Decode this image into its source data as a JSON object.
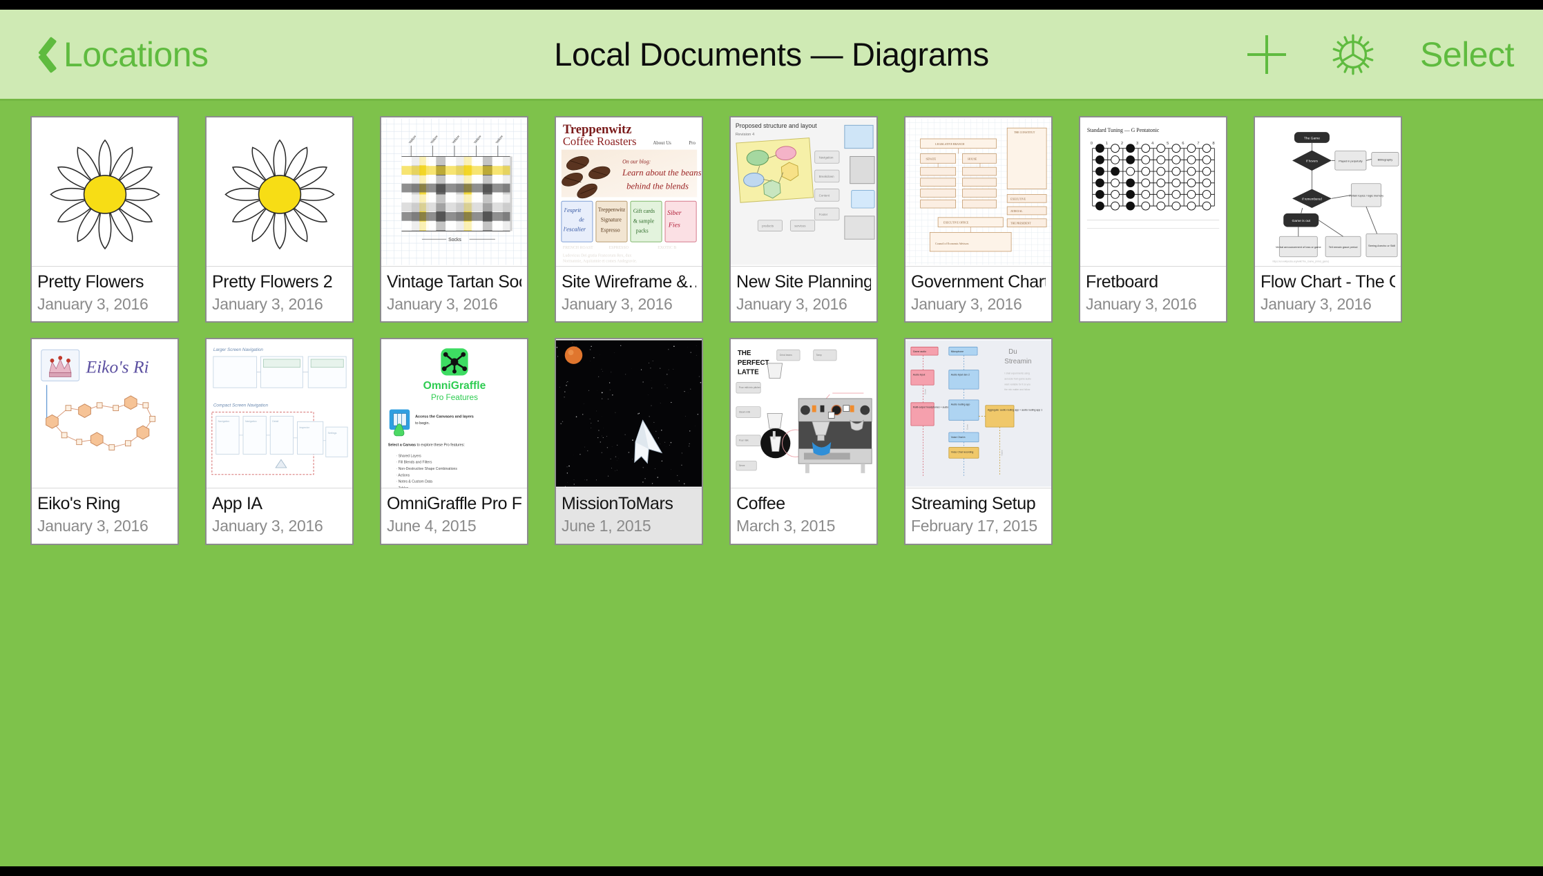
{
  "window": {
    "background_color": "#7ec24b",
    "outer_color": "#000000"
  },
  "navbar": {
    "background_color": "#cfeab4",
    "accent_color": "#5fbb3f",
    "back_label": "Locations",
    "back_icon": "chevron-left-icon",
    "title": "Local Documents — Diagrams",
    "add_icon": "plus-icon",
    "settings_icon": "gear-icon",
    "select_label": "Select"
  },
  "documents": [
    {
      "title": "Pretty Flowers",
      "date": "January 3, 2016",
      "thumb": "daisy",
      "dimmed": false
    },
    {
      "title": "Pretty Flowers 2",
      "date": "January 3, 2016",
      "thumb": "daisy",
      "dimmed": false
    },
    {
      "title": "Vintage Tartan Soc…",
      "date": "January 3, 2016",
      "thumb": "tartan",
      "dimmed": false
    },
    {
      "title": "Site Wireframe &…",
      "date": "January 3, 2016",
      "thumb": "treppenwitz",
      "dimmed": false
    },
    {
      "title": "New Site Planning",
      "date": "January 3, 2016",
      "thumb": "siteplan",
      "dimmed": false
    },
    {
      "title": "Government Chart",
      "date": "January 3, 2016",
      "thumb": "govchart",
      "dimmed": false
    },
    {
      "title": "Fretboard",
      "date": "January 3, 2016",
      "thumb": "fretboard",
      "dimmed": false
    },
    {
      "title": "Flow Chart - The G…",
      "date": "January 3, 2016",
      "thumb": "flowchart",
      "dimmed": false
    },
    {
      "title": "Eiko's Ring",
      "date": "January 3, 2016",
      "thumb": "eikosring",
      "dimmed": false
    },
    {
      "title": "App IA",
      "date": "January 3, 2016",
      "thumb": "appia",
      "dimmed": false
    },
    {
      "title": "OmniGraffle Pro Fe…",
      "date": "June 4, 2015",
      "thumb": "omnigraffle",
      "dimmed": false
    },
    {
      "title": "MissionToMars",
      "date": "June 1, 2015",
      "thumb": "mars",
      "dimmed": true
    },
    {
      "title": "Coffee",
      "date": "March 3, 2015",
      "thumb": "coffee",
      "dimmed": false
    },
    {
      "title": "Streaming Setup",
      "date": "February 17, 2015",
      "thumb": "streaming",
      "dimmed": false
    }
  ],
  "thumbnail_text": {
    "tartan": {
      "label": "Socks"
    },
    "treppenwitz": {
      "brand_line1": "Treppenwitz",
      "brand_line2": "Coffee Roasters",
      "nav1": "About Us",
      "nav2": "Pro",
      "blog_kicker": "On our blog:",
      "blog_line1": "Learn about the beans",
      "blog_line2": "behind the blends",
      "card1": "l'esprit de l'escalier",
      "card2": "Treppenwitz Signature Espresso",
      "card3": "Gift cards & sample packs",
      "card4": "Siber Fies"
    },
    "siteplan": {
      "heading": "Proposed structure and layout",
      "sub": "Revision 4"
    },
    "fretboard": {
      "heading": "Standard Tuning — G Pentatonic"
    },
    "flowchart": {
      "start": "The Game",
      "q1": "If hovers",
      "q2": "Played in perpetuity",
      "q3": "If remembered",
      "end": "Game is out"
    },
    "eikosring": {
      "title": "Eiko's Ri"
    },
    "appia": {
      "section1": "Larger Screen Navigation",
      "section2": "Compact Screen Navigation"
    },
    "omnigraffle": {
      "app_name": "OmniGraffle",
      "app_sub": "Pro Features",
      "callout": "Access the Canvases and layers to begin.",
      "select_line": "Select a Canvas to explore these Pro features:",
      "features": [
        "Shared Layers",
        "Fill Blends and Filters",
        "Non-Destructive Shape Combinations",
        "Actions",
        "Notes & Custom Data",
        "Tables"
      ]
    },
    "coffee": {
      "title_l1": "THE",
      "title_l2": "PERFECT",
      "title_l3": "LATTE"
    },
    "streaming": {
      "title_l1": "Du",
      "title_l2": "Streamin"
    }
  }
}
